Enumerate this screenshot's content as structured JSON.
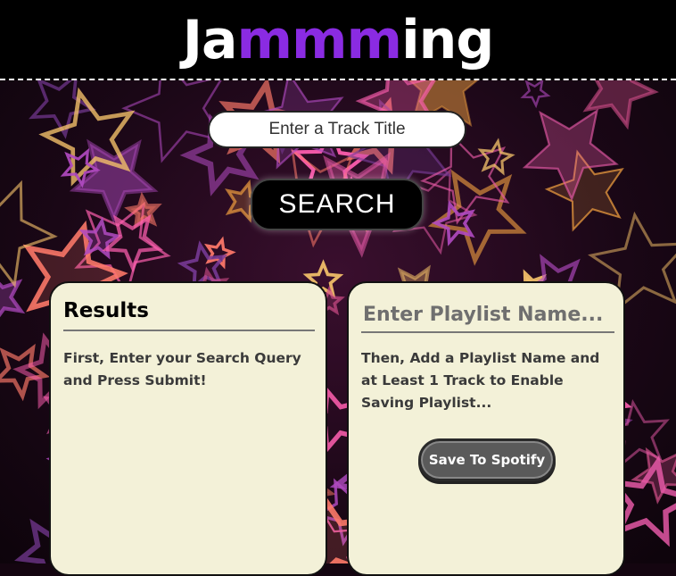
{
  "header": {
    "logo_prefix": "Ja",
    "logo_accent": "mmm",
    "logo_suffix": "ing",
    "accent_color": "#8a2be2"
  },
  "search": {
    "placeholder": "Enter a Track Title",
    "button_label": "SEARCH"
  },
  "results": {
    "title": "Results",
    "message": "First, Enter your Search Query and Press Submit!"
  },
  "playlist": {
    "name_placeholder": "Enter Playlist Name...",
    "message": "Then, Add a Playlist Name and at Least 1 Track to Enable Saving Playlist...",
    "save_label": "Save To Spotify"
  },
  "colors": {
    "panel_bg": "#f3f1d8",
    "header_bg": "#000000",
    "star_colors": [
      "#e85aa8",
      "#f0a040",
      "#b04ac0",
      "#ff7a6a",
      "#d24f8a",
      "#7a3c9a",
      "#f5c26a",
      "#ff5fb0"
    ]
  }
}
